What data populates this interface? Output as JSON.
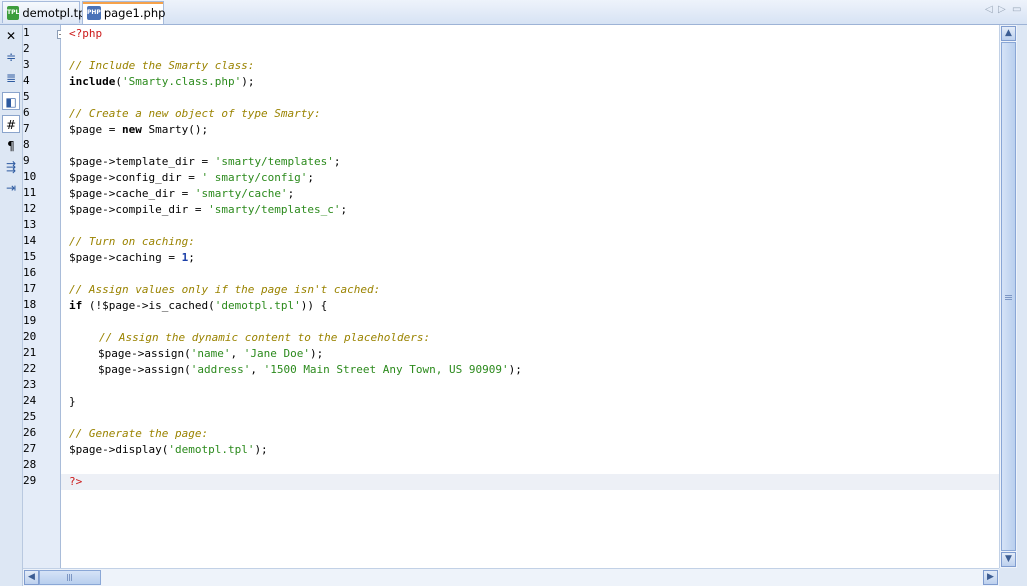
{
  "tabs": [
    {
      "label": "demotpl.tpl",
      "icon": "tpl-file-icon",
      "active": false
    },
    {
      "label": "page1.php",
      "icon": "php-file-icon",
      "active": true
    }
  ],
  "tab_nav": {
    "prev": "◁",
    "next": "▷",
    "menu": "▭"
  },
  "toolbar": [
    {
      "name": "close-icon",
      "glyph": "✕"
    },
    {
      "name": "shift-line-up-icon",
      "glyph": "≑"
    },
    {
      "name": "shift-line-down-icon",
      "glyph": "≣"
    },
    {
      "name": "toggle-bookmark-icon",
      "glyph": "◧"
    },
    {
      "name": "line-numbers-icon",
      "glyph": "#"
    },
    {
      "name": "show-whitespace-icon",
      "glyph": "¶"
    },
    {
      "name": "format-code-icon",
      "glyph": "⇶"
    },
    {
      "name": "indent-icon",
      "glyph": "⇥"
    }
  ],
  "editor": {
    "current_line": 29,
    "lines": [
      "1",
      "2",
      "3",
      "4",
      "5",
      "6",
      "7",
      "8",
      "9",
      "10",
      "11",
      "12",
      "13",
      "14",
      "15",
      "16",
      "17",
      "18",
      "19",
      "20",
      "21",
      "22",
      "23",
      "24",
      "25",
      "26",
      "27",
      "28",
      "29"
    ],
    "code": {
      "l1": "<?php",
      "l3": "// Include the Smarty class:",
      "l4_kw": "include",
      "l4_open": "(",
      "l4_str": "'Smarty.class.php'",
      "l4_close": ");",
      "l6": "// Create a new object of type Smarty:",
      "l7_a": "$page = ",
      "l7_kw": "new",
      "l7_b": " Smarty();",
      "l9_a": "$page->template_dir = ",
      "l9_str": "'smarty/templates'",
      "l9_b": ";",
      "l10_a": "$page->config_dir = ",
      "l10_str": "' smarty/config'",
      "l10_b": ";",
      "l11_a": "$page->cache_dir = ",
      "l11_str": "'smarty/cache'",
      "l11_b": ";",
      "l12_a": "$page->compile_dir = ",
      "l12_str": "'smarty/templates_c'",
      "l12_b": ";",
      "l14": "// Turn on caching:",
      "l15_a": "$page->caching = ",
      "l15_num": "1",
      "l15_b": ";",
      "l17": "// Assign values only if the page isn't cached:",
      "l18_kw": "if",
      "l18_a": " (!$page->is_cached(",
      "l18_str": "'demotpl.tpl'",
      "l18_b": ")) {",
      "l20": "// Assign the dynamic content to the placeholders:",
      "l21_a": "$page->assign(",
      "l21_s1": "'name'",
      "l21_sep": ", ",
      "l21_s2": "'Jane Doe'",
      "l21_b": ");",
      "l22_a": "$page->assign(",
      "l22_s1": "'address'",
      "l22_sep": ", ",
      "l22_s2": "'1500 Main Street Any Town, US 90909'",
      "l22_b": ");",
      "l24": "}",
      "l26": "// Generate the page:",
      "l27_a": "$page->display(",
      "l27_str": "'demotpl.tpl'",
      "l27_b": ");",
      "l29": "?>"
    }
  },
  "colors": {
    "comment": "#9a8300",
    "string": "#2b8a1c",
    "tag": "#cc1b1b",
    "number": "#1b3fa8"
  }
}
